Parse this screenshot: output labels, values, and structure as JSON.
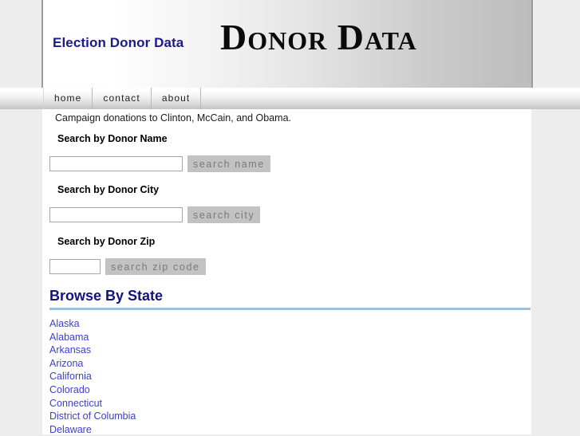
{
  "header": {
    "site_title": "Election Donor Data",
    "logo_wordmark": "Donor Data"
  },
  "nav": {
    "items": [
      {
        "label": "home"
      },
      {
        "label": "contact"
      },
      {
        "label": "about"
      }
    ]
  },
  "main": {
    "intro_text": "Campaign donations to Clinton, McCain, and Obama.",
    "search_forms": [
      {
        "label": "Search by Donor Name",
        "input_value": "",
        "input_placeholder": "",
        "button_label": "search name"
      },
      {
        "label": "Search by Donor City",
        "input_value": "",
        "input_placeholder": "",
        "button_label": "search city"
      },
      {
        "label": "Search by Donor Zip",
        "input_value": "",
        "input_placeholder": "",
        "button_label": "search zip code"
      }
    ],
    "browse": {
      "heading": "Browse By State",
      "states": [
        "Alaska",
        "Alabama",
        "Arkansas",
        "Arizona",
        "California",
        "Colorado",
        "Connecticut",
        "District of Columbia",
        "Delaware"
      ]
    }
  },
  "colors": {
    "site_title": "#1a1a8c",
    "heading_navy": "#131380",
    "link_blue": "#3d3dd6",
    "rule_blue": "#9ec0d8",
    "button_gray": "#c2c2c2",
    "page_background": "#ededed"
  }
}
